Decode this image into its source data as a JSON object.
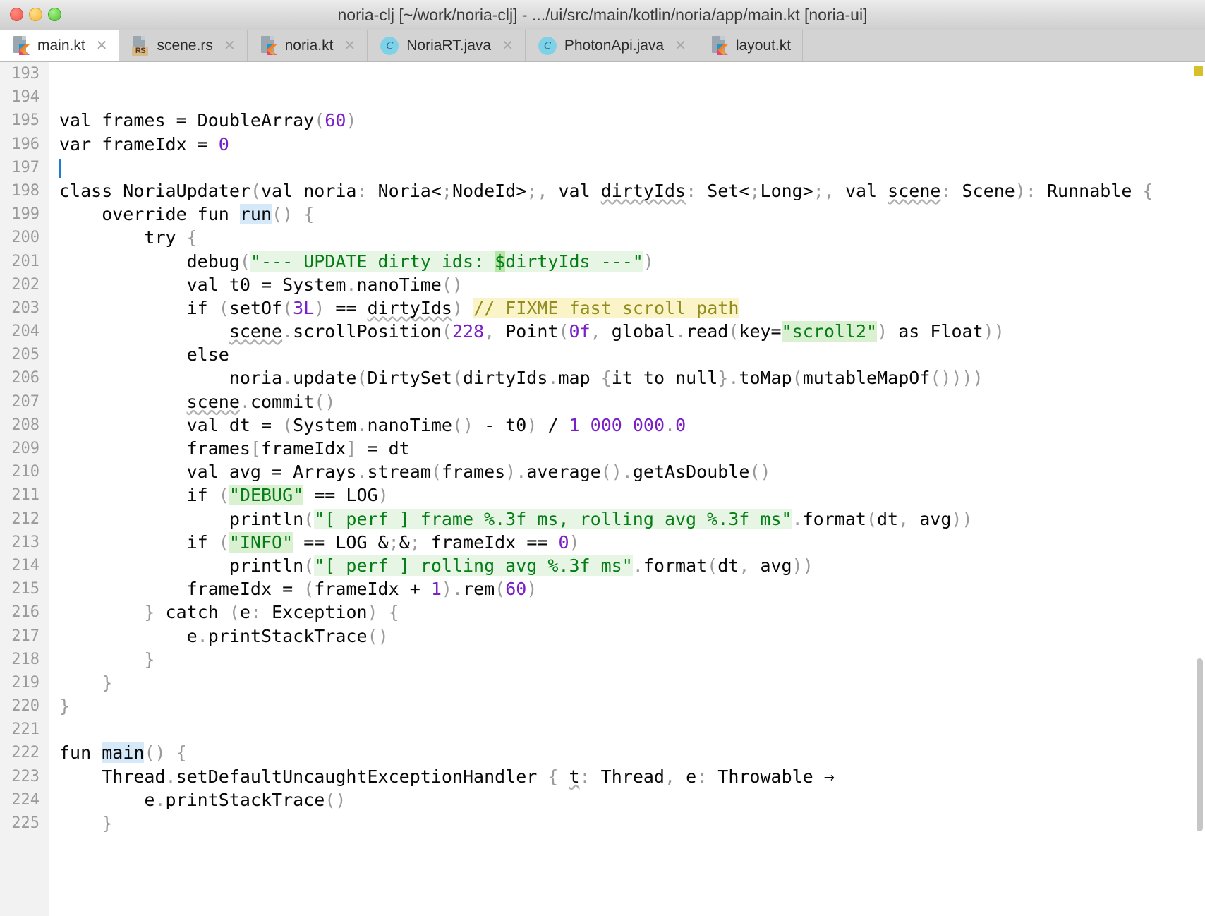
{
  "window": {
    "title": "noria-clj [~/work/noria-clj] - .../ui/src/main/kotlin/noria/app/main.kt [noria-ui]",
    "traffic_lights": [
      "close",
      "minimize",
      "zoom"
    ],
    "colors": {
      "close": "#f2564c",
      "minimize": "#f2b735",
      "zoom": "#49c12c",
      "titlebar_bg": "#dcdcdc",
      "tabbar_bg": "#d3d3d3",
      "active_tab_bg": "#ffffff",
      "editor_bg": "#ffffff",
      "gutter_bg": "#f2f2f2",
      "string": "#067d17",
      "number": "#7a20c4",
      "comment": "#8c8c00",
      "comment_highlight": "#fbf4c8",
      "string_highlight": "#e7f5e4",
      "caret_identifier_highlight": "#d6e9f8",
      "caret": "#1a7fd4",
      "warning_marker": "#d8c02a"
    }
  },
  "tabs": [
    {
      "label": "main.kt",
      "icon": "kotlin-file-icon",
      "active": true,
      "close_glyph": "✕"
    },
    {
      "label": "scene.rs",
      "icon": "rust-file-icon",
      "active": false,
      "close_glyph": "✕"
    },
    {
      "label": "noria.kt",
      "icon": "kotlin-file-icon",
      "active": false,
      "close_glyph": "✕"
    },
    {
      "label": "NoriaRT.java",
      "icon": "java-class-icon",
      "active": false,
      "close_glyph": "✕"
    },
    {
      "label": "PhotonApi.java",
      "icon": "java-class-icon",
      "active": false,
      "close_glyph": "✕"
    },
    {
      "label": "layout.kt",
      "icon": "kotlin-file-icon",
      "active": false,
      "close_glyph": ""
    }
  ],
  "editor": {
    "first_line": 193,
    "last_line": 225,
    "line_numbers": [
      193,
      194,
      195,
      196,
      197,
      198,
      199,
      200,
      201,
      202,
      203,
      204,
      205,
      206,
      207,
      208,
      209,
      210,
      211,
      212,
      213,
      214,
      215,
      216,
      217,
      218,
      219,
      220,
      221,
      222,
      223,
      224,
      225
    ],
    "lines": [
      "",
      "",
      "val frames = DoubleArray(60)",
      "var frameIdx = 0",
      "",
      "class NoriaUpdater(val noria: Noria<NodeId>, val dirtyIds: Set<Long>, val scene: Scene): Runnable {",
      "    override fun run() {",
      "        try {",
      "            debug(\"--- UPDATE dirty ids: $dirtyIds ---\")",
      "            val t0 = System.nanoTime()",
      "            if (setOf(3L) == dirtyIds) // FIXME fast scroll path",
      "                scene.scrollPosition(228, Point(0f, global.read(key=\"scroll2\") as Float))",
      "            else",
      "                noria.update(DirtySet(dirtyIds.map {it to null}.toMap(mutableMapOf())))",
      "            scene.commit()",
      "            val dt = (System.nanoTime() - t0) / 1_000_000.0",
      "            frames[frameIdx] = dt",
      "            val avg = Arrays.stream(frames).average().getAsDouble()",
      "            if (\"DEBUG\" == LOG)",
      "                println(\"[ perf ] frame %.3f ms, rolling avg %.3f ms\".format(dt, avg))",
      "            if (\"INFO\" == LOG && frameIdx == 0)",
      "                println(\"[ perf ] rolling avg %.3f ms\".format(dt, avg))",
      "            frameIdx = (frameIdx + 1).rem(60)",
      "        } catch (e: Exception) {",
      "            e.printStackTrace()",
      "        }",
      "    }",
      "}",
      "",
      "fun main() {",
      "    Thread.setDefaultUncaughtExceptionHandler { t: Thread, e: Throwable →",
      "        e.printStackTrace()",
      "    }"
    ],
    "caret_line": 197,
    "caret_highlighted_identifiers": [
      "run",
      "main"
    ],
    "inline_warning_comment": "// FIXME fast scroll path",
    "squiggly_underlined": [
      "dirtyIds",
      "scene",
      "getAsDouble",
      "t"
    ]
  }
}
